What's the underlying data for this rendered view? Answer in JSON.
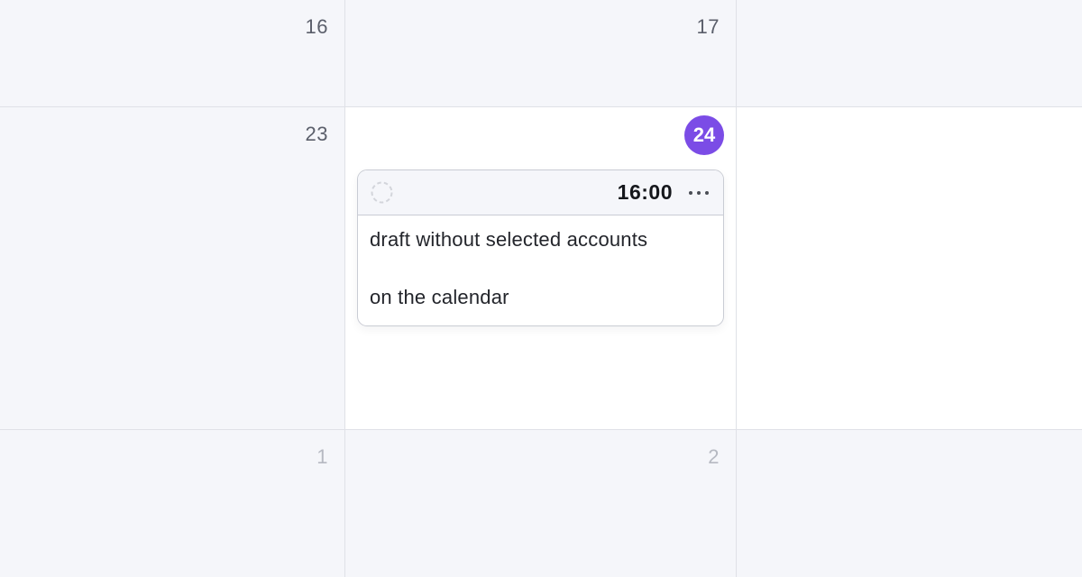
{
  "calendar": {
    "rows": [
      {
        "cells": [
          {
            "day": "16"
          },
          {
            "day": "17"
          },
          {
            "day": ""
          }
        ]
      },
      {
        "cells": [
          {
            "day": "23"
          },
          {
            "day": "24",
            "today": true
          },
          {
            "day": ""
          }
        ]
      },
      {
        "cells": [
          {
            "day": "1"
          },
          {
            "day": "2"
          },
          {
            "day": ""
          }
        ]
      }
    ],
    "today_color": "#7b4ce6"
  },
  "post": {
    "status_icon": "dashed-circle-icon",
    "time": "16:00",
    "more_icon": "more-horizontal-icon",
    "lines": [
      "draft without selected accounts",
      "on the calendar"
    ]
  }
}
